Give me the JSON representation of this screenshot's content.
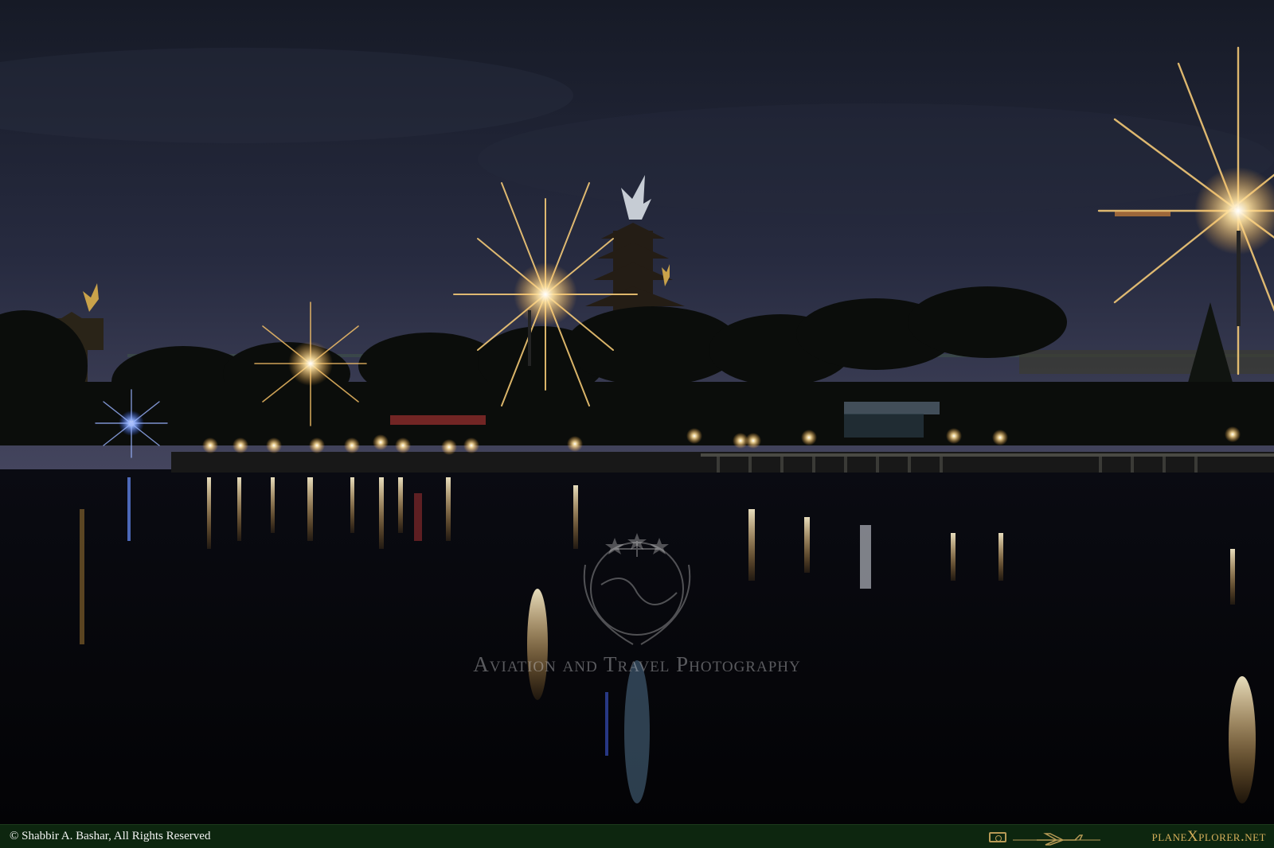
{
  "watermark": {
    "text": "Aviation and Travel Photography",
    "logo_icon": "globe-stars-wreath-icon"
  },
  "footer": {
    "copyright": "© Shabbir A. Bashar, All Rights Reserved",
    "brand": "planeXplorer.net",
    "camera_icon": "camera-icon",
    "plane_icon": "airplane-icon"
  },
  "colors": {
    "sky_top": "#1c2130",
    "sky_horizon": "#3b3e58",
    "water": "#05060a",
    "light_warm": "#ffc35a",
    "light_blue": "#5a8cff",
    "footer_bg": "#0d260f",
    "brand_gold": "#d4ae5a"
  }
}
